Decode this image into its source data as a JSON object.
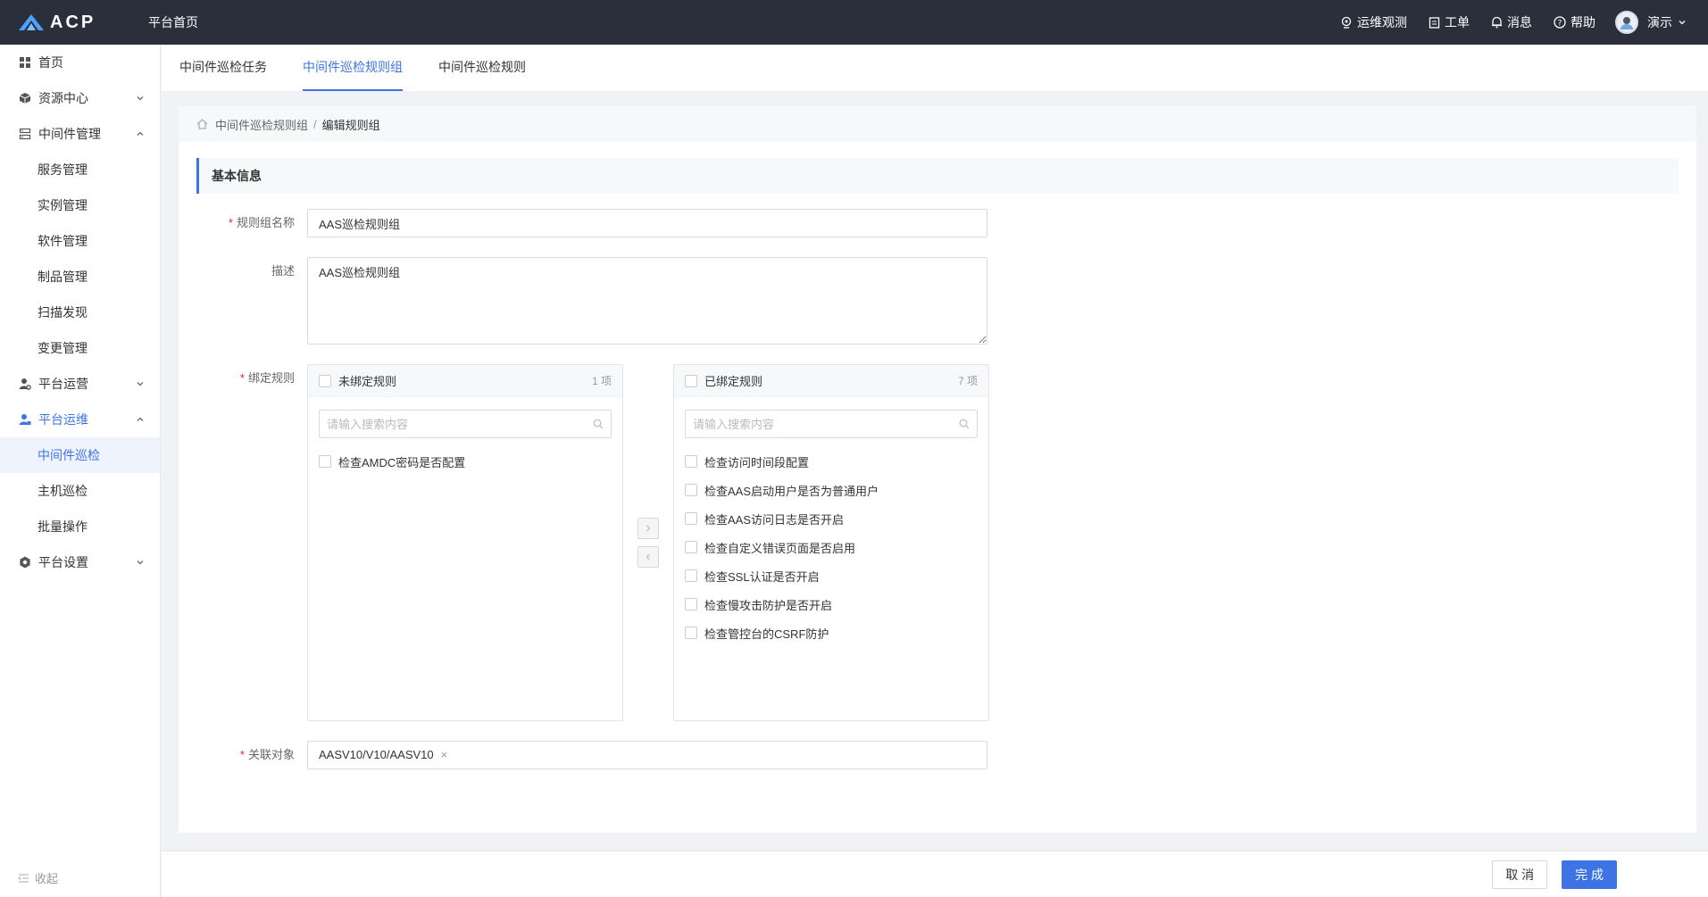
{
  "app": {
    "logo_text": "ACP",
    "home_title": "平台首页"
  },
  "topbar": {
    "items": [
      {
        "label": "运维观测",
        "icon": "monitor-icon"
      },
      {
        "label": "工单",
        "icon": "clipboard-icon"
      },
      {
        "label": "消息",
        "icon": "bell-icon"
      },
      {
        "label": "帮助",
        "icon": "help-icon"
      }
    ],
    "user": "演示"
  },
  "sidebar": {
    "items": [
      {
        "label": "首页",
        "icon": "grid-icon"
      },
      {
        "label": "资源中心",
        "icon": "cube-icon",
        "expanded": false
      },
      {
        "label": "中间件管理",
        "icon": "server-icon",
        "expanded": true
      },
      {
        "label": "平台运营",
        "icon": "user-gear-icon",
        "expanded": false
      },
      {
        "label": "平台运维",
        "icon": "user-wrench-icon",
        "expanded": true
      },
      {
        "label": "平台设置",
        "icon": "settings-icon",
        "expanded": false
      }
    ],
    "middleware_sub": [
      "服务管理",
      "实例管理",
      "软件管理",
      "制品管理",
      "扫描发现",
      "变更管理"
    ],
    "ops_sub": [
      "中间件巡检",
      "主机巡检",
      "批量操作"
    ],
    "active_sub": "中间件巡检",
    "collapse_label": "收起"
  },
  "tabs": [
    "中间件巡检任务",
    "中间件巡检规则组",
    "中间件巡检规则"
  ],
  "active_tab": "中间件巡检规则组",
  "breadcrumb": {
    "parent": "中间件巡检规则组",
    "sep": "/",
    "current": "编辑规则组"
  },
  "section_title": "基本信息",
  "form": {
    "name_label": "规则组名称",
    "name_value": "AAS巡检规则组",
    "desc_label": "描述",
    "desc_value": "AAS巡检规则组",
    "bind_label": "绑定规则",
    "target_label": "关联对象",
    "target_tag": "AASV10/V10/AASV10",
    "target_tag_close": "×"
  },
  "transfer": {
    "left": {
      "title": "未绑定规则",
      "count": "1 项",
      "placeholder": "请输入搜索内容",
      "items": [
        "检查AMDC密码是否配置"
      ]
    },
    "right": {
      "title": "已绑定规则",
      "count": "7 项",
      "placeholder": "请输入搜索内容",
      "items": [
        "检查访问时间段配置",
        "检查AAS启动用户是否为普通用户",
        "检查AAS访问日志是否开启",
        "检查自定义错误页面是否启用",
        "检查SSL认证是否开启",
        "检查慢攻击防护是否开启",
        "检查管控台的CSRF防护"
      ]
    }
  },
  "footer": {
    "cancel": "取 消",
    "confirm": "完 成"
  },
  "colors": {
    "primary": "#3e73e6",
    "topbar": "#2b2f3c",
    "required": "#f5222d"
  }
}
